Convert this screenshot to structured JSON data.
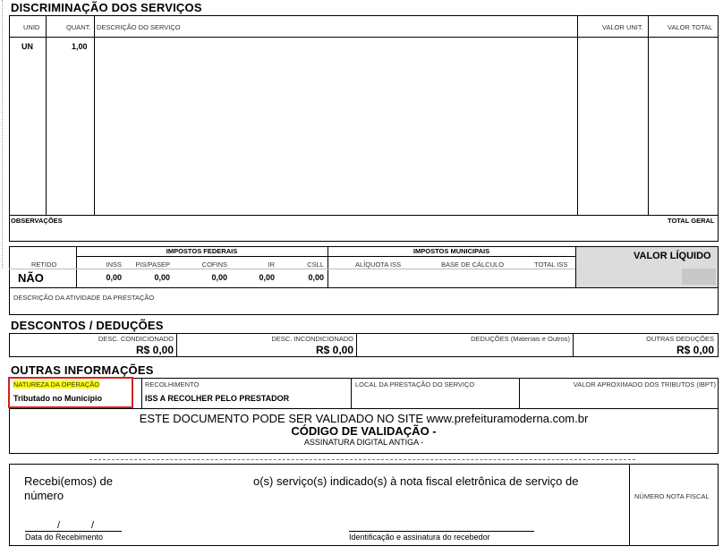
{
  "services": {
    "title": "DISCRIMINAÇÃO DOS SERVIÇOS",
    "headers": {
      "unid": "UNID",
      "quant": "QUANT.",
      "descricao": "DESCRIÇÃO DO SERVIÇO",
      "valor_unit": "VALOR UNIT.",
      "valor_total": "VALOR TOTAL"
    },
    "row": {
      "unid": "UN",
      "quant": "1,00"
    }
  },
  "observacoes": {
    "label": "OBSERVAÇÕES",
    "total_geral_label": "TOTAL GERAL"
  },
  "impostos": {
    "federais_title": "IMPOSTOS FEDERAIS",
    "municipais_title": "IMPOSTOS MUNICIPAIS",
    "retido_label": "RETIDO",
    "retido_value": "NÃO",
    "federais": [
      {
        "label": "INSS",
        "value": "0,00"
      },
      {
        "label": "PIS/PASEP",
        "value": "0,00"
      },
      {
        "label": "COFINS",
        "value": "0,00"
      },
      {
        "label": "IR",
        "value": "0,00"
      },
      {
        "label": "CSLL",
        "value": "0,00"
      }
    ],
    "municipais": [
      {
        "label": "ALÍQUOTA ISS"
      },
      {
        "label": "BASE DE CÁLCULO"
      },
      {
        "label": "TOTAL ISS"
      }
    ],
    "valor_liquido_label": "VALOR LÍQUIDO"
  },
  "atividade": {
    "label": "DESCRIÇÃO DA ATIVIDADE DA PRESTAÇÃO"
  },
  "descontos": {
    "title": "DESCONTOS / DEDUÇÕES",
    "items": [
      {
        "label": "DESC. CONDICIONADO",
        "value": "R$ 0,00"
      },
      {
        "label": "DESC. INCONDICIONADO",
        "value": "R$ 0,00"
      },
      {
        "label": "DEDUÇÕES (Materiais e Outros)",
        "value": ""
      },
      {
        "label": "OUTRAS DEDUÇÕES",
        "value": "R$ 0,00"
      }
    ]
  },
  "outras": {
    "title": "OUTRAS INFORMAÇÕES",
    "natureza_label": "NATUREZA DA OPERAÇÃO",
    "natureza_value": "Tributado no Município",
    "recolhimento_label": "RECOLHIMENTO",
    "recolhimento_value": "ISS A RECOLHER PELO PRESTADOR",
    "local_label": "LOCAL DA PRESTAÇÃO DO SERVIÇO",
    "valor_aprox_label": "VALOR APROXIMADO DOS TRIBUTOS (IBPT)",
    "validacao_text": "ESTE DOCUMENTO PODE SER VALIDADO NO SITE www.prefeituramoderna.com.br",
    "codigo_label": "CÓDIGO DE VALIDAÇÃO -",
    "assinatura_label": "ASSINATURA DIGITAL ANTIGA -"
  },
  "recibo": {
    "text1": "Recebi(emos) de",
    "text2": "o(s) serviço(s) indicado(s) à nota fiscal eletrônica de serviço de",
    "text3": "número",
    "date_sep": "/",
    "data_label": "Data do Recebimento",
    "ident_label": "Identificação e assinatura do recebedor",
    "numero_nota_label": "NÚMERO NOTA FISCAL"
  },
  "colors": {
    "highlight": "#ffff00",
    "red_box": "#d62020",
    "gray_panel": "#dcdcdc"
  }
}
